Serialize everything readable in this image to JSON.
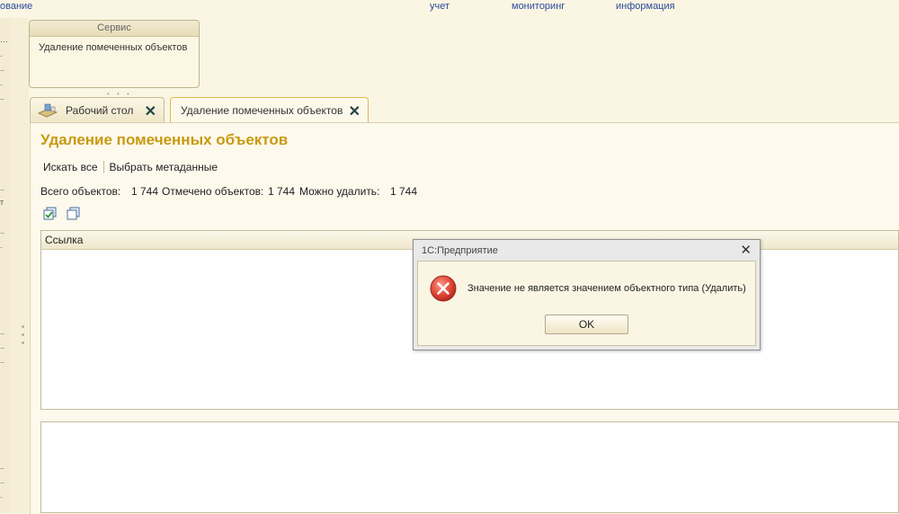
{
  "top_menu": {
    "item1": "ование",
    "item2": "учет",
    "item3": "мониторинг",
    "item4": "информация"
  },
  "service_panel": {
    "title": "Сервис",
    "link": "Удаление помеченных объектов"
  },
  "tabs": [
    {
      "label": "Рабочий стол"
    },
    {
      "label": "Удаление помеченных объектов"
    }
  ],
  "page": {
    "title": "Удаление помеченных объектов",
    "commands": {
      "find_all": "Искать все",
      "select_metadata": "Выбрать метаданные"
    },
    "stats": {
      "total_label": "Всего объектов:",
      "total_value": "1 744",
      "marked_label": "Отмечено объектов:",
      "marked_value": "1 744",
      "deletable_label": "Можно удалить:",
      "deletable_value": "1 744"
    },
    "table": {
      "column_link": "Ссылка"
    }
  },
  "dialog": {
    "title": "1С:Предприятие",
    "message": "Значение не является значением объектного типа (Удалить)",
    "ok_label": "OK"
  },
  "left_panel": {
    "stray_char": "т"
  },
  "colors": {
    "accent_title": "#c79a10",
    "background": "#fbf6e4",
    "error_icon": "#d93a2e"
  }
}
